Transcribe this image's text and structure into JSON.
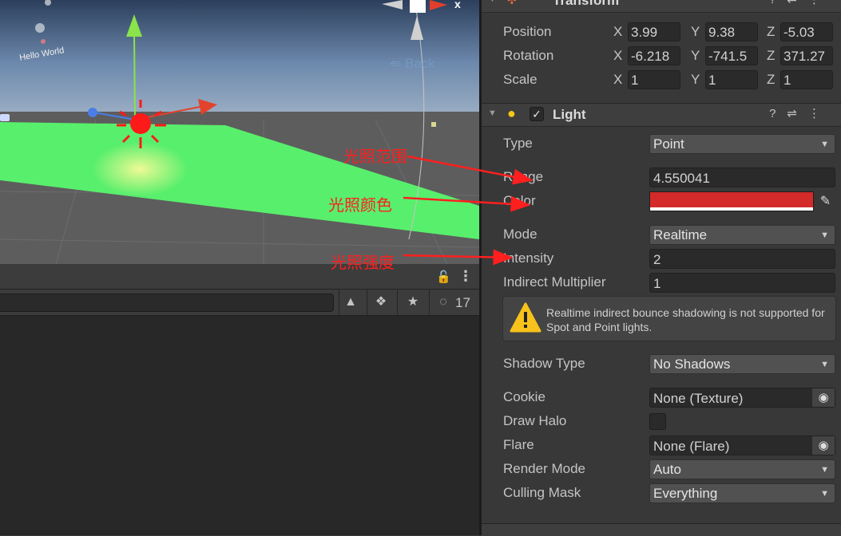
{
  "scene": {
    "hello_text": "Hello World",
    "back_text": "Back",
    "close_text": "x"
  },
  "hierarchy": {
    "hidden_count": "17",
    "icons": [
      "lock-icon",
      "kebab-menu-icon",
      "filter-by-type-icon",
      "filter-by-label-icon",
      "favorites-icon",
      "hidden-objects-icon"
    ]
  },
  "transform": {
    "title": "Transform",
    "rows": [
      {
        "label": "Position",
        "x": "3.99",
        "y": "9.38",
        "z": "-5.03"
      },
      {
        "label": "Rotation",
        "x": "-6.218",
        "y": "-741.5",
        "z": "371.27"
      },
      {
        "label": "Scale",
        "x": "1",
        "y": "1",
        "z": "1"
      }
    ],
    "axis": {
      "x": "X",
      "y": "Y",
      "z": "Z"
    }
  },
  "light": {
    "title": "Light",
    "enabled": true,
    "type_label": "Type",
    "type_value": "Point",
    "range_label": "Range",
    "range_value": "4.550041",
    "color_label": "Color",
    "color_value": "#d42a2a",
    "mode_label": "Mode",
    "mode_value": "Realtime",
    "intensity_label": "Intensity",
    "intensity_value": "2",
    "indirect_label": "Indirect Multiplier",
    "indirect_value": "1",
    "warning": "Realtime indirect bounce shadowing is not supported for Spot and Point lights.",
    "shadow_label": "Shadow Type",
    "shadow_value": "No Shadows",
    "cookie_label": "Cookie",
    "cookie_value": "None (Texture)",
    "halo_label": "Draw Halo",
    "halo_checked": false,
    "flare_label": "Flare",
    "flare_value": "None (Flare)",
    "render_label": "Render Mode",
    "render_value": "Auto",
    "culling_label": "Culling Mask",
    "culling_value": "Everything"
  },
  "annotations": [
    {
      "text": "光照范围",
      "color": "#ff1f1f"
    },
    {
      "text": "光照颜色",
      "color": "#ff1f1f"
    },
    {
      "text": "光照强度",
      "color": "#ff1f1f"
    }
  ]
}
